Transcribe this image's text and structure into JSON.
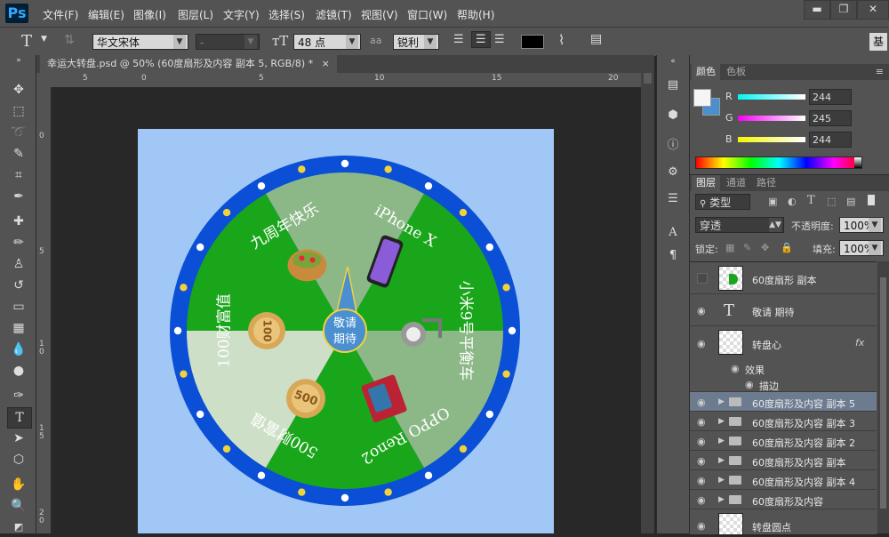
{
  "app": {
    "logo": "Ps"
  },
  "menu": [
    "文件(F)",
    "编辑(E)",
    "图像(I)",
    "图层(L)",
    "文字(Y)",
    "选择(S)",
    "滤镜(T)",
    "视图(V)",
    "窗口(W)",
    "帮助(H)"
  ],
  "window_buttons": {
    "minimize": "▬",
    "restore": "❐",
    "close": "✕"
  },
  "options": {
    "tool_glyph": "T",
    "font_family": "华文宋体",
    "font_style": "-",
    "font_size": "48 点",
    "aa_label": "aa",
    "antialias": "锐利",
    "text_color": "#000000",
    "workspace_button": "基"
  },
  "document": {
    "tab_title": "幸运大转盘.psd @ 50% (60度扇形及内容 副本 5, RGB/8) *",
    "close": "×"
  },
  "ruler": {
    "h": [
      "5",
      "0",
      "5",
      "10",
      "15",
      "20"
    ],
    "v": [
      "0",
      "5",
      "1\n0",
      "1\n5",
      "2\n0"
    ]
  },
  "wheel": {
    "center_text_1": "敬请",
    "center_text_2": "期待",
    "segments": [
      "九周年快乐",
      "iPhone X",
      "小米9号平衡车",
      "OPPO Reno2",
      "500财富值",
      "100财富值"
    ],
    "colors": {
      "ring": "#0a4fd6",
      "light_green": "#8cb888",
      "green": "#1aa61a",
      "pale_green": "#cde0c7",
      "center": "#4a8fd0",
      "background": "#a0c7f5"
    },
    "coin_100": "100",
    "coin_500": "500"
  },
  "color_panel": {
    "tabs": [
      "颜色",
      "色板"
    ],
    "r_label": "R",
    "g_label": "G",
    "b_label": "B",
    "r": "244",
    "g": "245",
    "b": "244"
  },
  "layers_panel": {
    "tabs": [
      "图层",
      "通道",
      "路径"
    ],
    "filter": "类型",
    "blend_mode": "穿透",
    "opacity_label": "不透明度:",
    "opacity": "100%",
    "lock_label": "锁定:",
    "fill_label": "填充:",
    "fill": "100%",
    "fx": "fx",
    "layers": [
      {
        "name": "60度扇形 副本",
        "type": "image",
        "visible": false
      },
      {
        "name": "敬请 期待",
        "type": "text",
        "visible": true
      },
      {
        "name": "转盘心",
        "type": "image",
        "visible": true,
        "fx": true
      },
      {
        "name": "效果",
        "type": "effect",
        "visible": true
      },
      {
        "name": "描边",
        "type": "effect-item",
        "visible": true
      },
      {
        "name": "60度扇形及内容 副本 5",
        "type": "group",
        "visible": true,
        "selected": true
      },
      {
        "name": "60度扇形及内容 副本 3",
        "type": "group",
        "visible": true
      },
      {
        "name": "60度扇形及内容 副本 2",
        "type": "group",
        "visible": true
      },
      {
        "name": "60度扇形及内容 副本",
        "type": "group",
        "visible": true
      },
      {
        "name": "60度扇形及内容 副本 4",
        "type": "group",
        "visible": true
      },
      {
        "name": "60度扇形及内容",
        "type": "group",
        "visible": true
      },
      {
        "name": "转盘圆点",
        "type": "image",
        "visible": true
      }
    ]
  }
}
